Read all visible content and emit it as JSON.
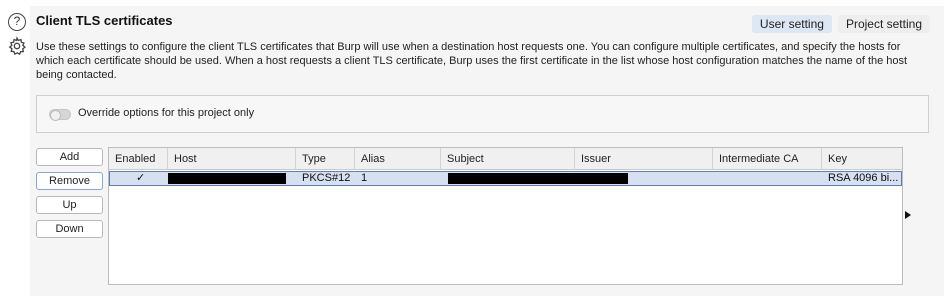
{
  "header": {
    "title": "Client TLS certificates",
    "help_icon": "?",
    "tabs": [
      {
        "label": "User setting",
        "active": true
      },
      {
        "label": "Project setting",
        "active": false
      }
    ]
  },
  "description": "Use these settings to configure the client TLS certificates that Burp will use when a destination host requests one. You can configure multiple certificates, and specify the hosts for which each certificate should be used. When a host requests a client TLS certificate, Burp uses the first certificate in the list whose host configuration matches the name of the host being contacted.",
  "override": {
    "label": "Override options for this project only",
    "enabled": false
  },
  "buttons": {
    "add": "Add",
    "remove": "Remove",
    "up": "Up",
    "down": "Down"
  },
  "table": {
    "columns": [
      "Enabled",
      "Host",
      "Type",
      "Alias",
      "Subject",
      "Issuer",
      "Intermediate CA",
      "Key"
    ],
    "rows": [
      {
        "enabled": "✓",
        "host": "",
        "type": "PKCS#12",
        "alias": "1",
        "subject": "",
        "issuer": "",
        "intermediate_ca": "",
        "key": "RSA 4096 bi..."
      }
    ]
  },
  "colors": {
    "selected_row": "#d6e0f0",
    "active_tab": "#dde6f3"
  }
}
